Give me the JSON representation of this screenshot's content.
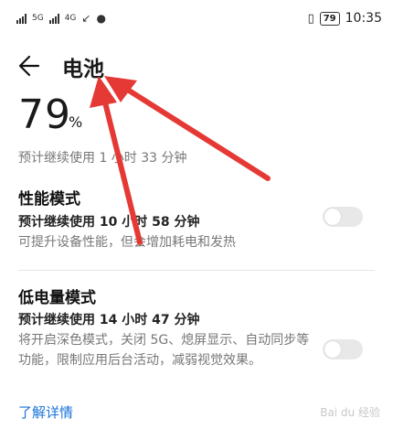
{
  "status_bar": {
    "sim1": "5G",
    "sim2": "4G",
    "battery_level": "79",
    "time": "10:35"
  },
  "header": {
    "title": "电池"
  },
  "battery": {
    "percent": "79",
    "unit": "%",
    "remaining": "预计继续使用 1 小时 33 分钟"
  },
  "performance_mode": {
    "title": "性能模式",
    "time": "预计继续使用 10 小时 58 分钟",
    "description": "可提升设备性能，但会增加耗电和发热",
    "enabled": false
  },
  "low_power_mode": {
    "title": "低电量模式",
    "time": "预计继续使用 14 小时 47 分钟",
    "description": "将开启深色模式，关闭 5G、熄屏显示、自动同步等功能，限制应用后台活动，减弱视觉效果。",
    "enabled": false
  },
  "learn_more": "了解详情",
  "watermark": "Bai du 经验",
  "colors": {
    "link": "#1a73d9",
    "annotation": "#e53935"
  }
}
